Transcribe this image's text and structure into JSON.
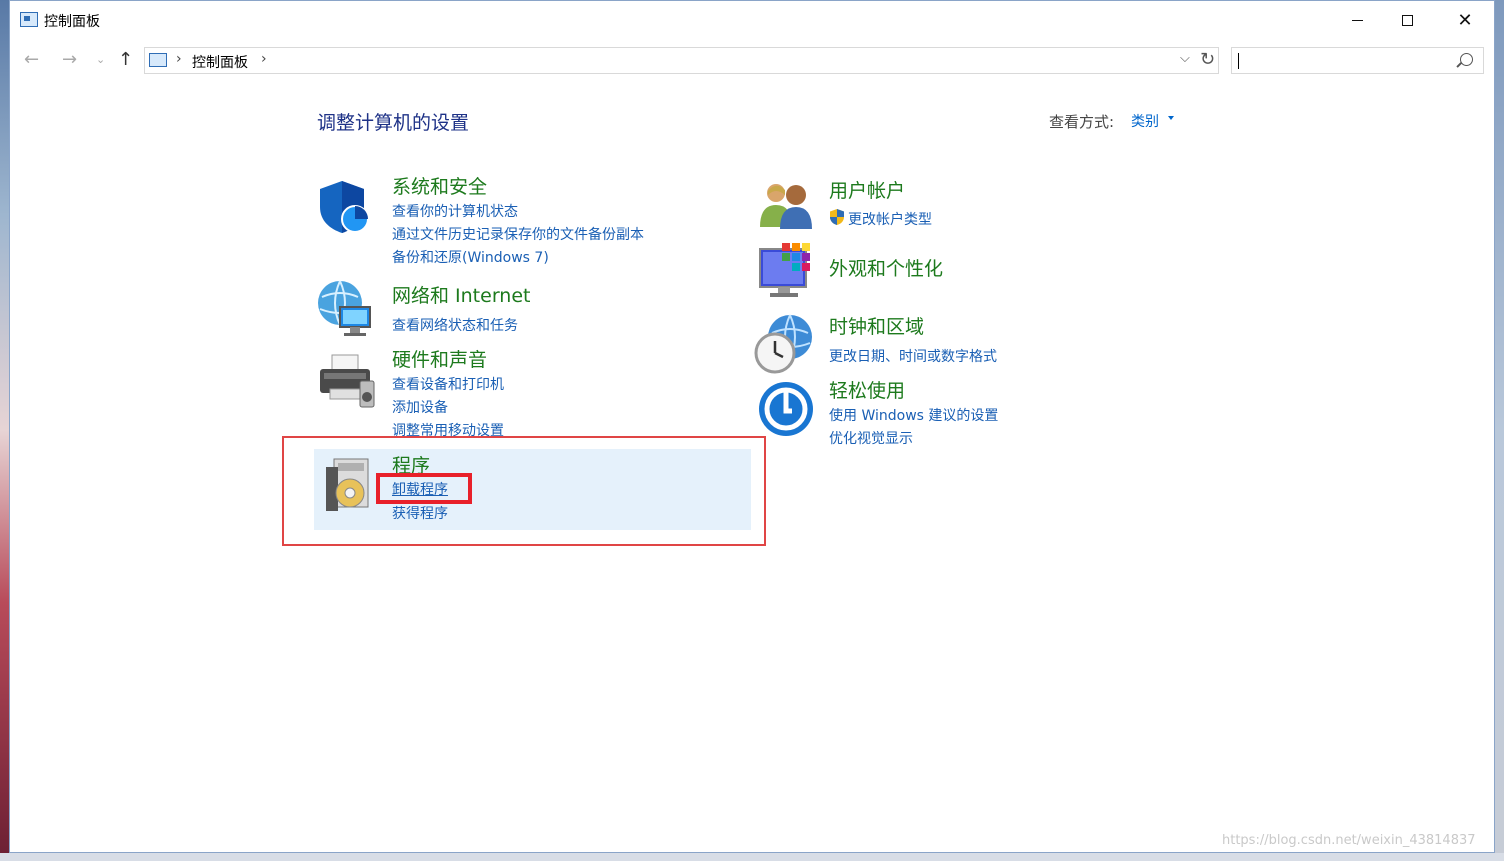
{
  "window": {
    "title": "控制面板",
    "controls": {
      "minimize": "minimize",
      "maximize": "maximize",
      "close": "✕"
    }
  },
  "address_bar": {
    "breadcrumb": [
      "控制面板"
    ],
    "search_placeholder": ""
  },
  "content": {
    "page_title": "调整计算机的设置",
    "view_by_label": "查看方式:",
    "view_by_value": "类别"
  },
  "categories": {
    "system_security": {
      "title": "系统和安全",
      "links": [
        "查看你的计算机状态",
        "通过文件历史记录保存你的文件备份副本",
        "备份和还原(Windows 7)"
      ]
    },
    "network": {
      "title": "网络和 Internet",
      "links": [
        "查看网络状态和任务"
      ]
    },
    "hardware": {
      "title": "硬件和声音",
      "links": [
        "查看设备和打印机",
        "添加设备",
        "调整常用移动设置"
      ]
    },
    "programs": {
      "title": "程序",
      "links": [
        "卸载程序",
        "获得程序"
      ]
    },
    "user_accounts": {
      "title": "用户帐户",
      "links": [
        "更改帐户类型"
      ]
    },
    "appearance": {
      "title": "外观和个性化",
      "links": []
    },
    "clock_region": {
      "title": "时钟和区域",
      "links": [
        "更改日期、时间或数字格式"
      ]
    },
    "ease_access": {
      "title": "轻松使用",
      "links": [
        "使用 Windows 建议的设置",
        "优化视觉显示"
      ]
    }
  },
  "icons": {
    "system_security": "shield-icon",
    "network": "network-globe-icon",
    "hardware": "printer-icon",
    "programs": "programs-disc-icon",
    "user_accounts": "users-icon",
    "appearance": "display-palette-icon",
    "clock_region": "clock-globe-icon",
    "ease_access": "ease-of-access-icon"
  },
  "colors": {
    "category_title": "#1d7a1d",
    "link": "#1a5fb4",
    "page_title": "#1e3287",
    "highlight_box": "#e8202a"
  },
  "watermark": "https://blog.csdn.net/weixin_43814837"
}
